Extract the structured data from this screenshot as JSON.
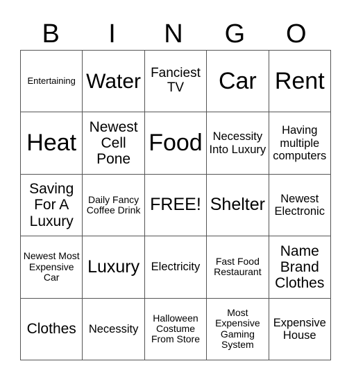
{
  "header": {
    "letters": [
      "B",
      "I",
      "N",
      "G",
      "O"
    ]
  },
  "board": {
    "rows": [
      [
        "Entertaining",
        "Water",
        "Fanciest TV",
        "Car",
        "Rent"
      ],
      [
        "Heat",
        "Newest Cell Pone",
        "Food",
        "Necessity Into Luxury",
        "Having multiple computers"
      ],
      [
        "Saving For A Luxury",
        "Daily Fancy Coffee Drink",
        "FREE!",
        "Shelter",
        "Newest Electronic"
      ],
      [
        "Newest Most Expensive Car",
        "Luxury",
        "Electricity",
        "Fast Food Restaurant",
        "Name Brand Clothes"
      ],
      [
        "Clothes",
        "Necessity",
        "Halloween Costume From Store",
        "Most Expensive Gaming System",
        "Expensive House"
      ]
    ]
  }
}
